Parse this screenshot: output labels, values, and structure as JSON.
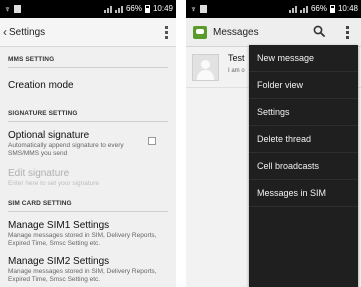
{
  "left_phone": {
    "status_bar": {
      "battery": "66%",
      "time": "10:49"
    },
    "action_bar": {
      "back": "‹",
      "title": "Settings"
    },
    "sections": [
      {
        "header": "MMS SETTING",
        "items": [
          {
            "title": "Creation mode",
            "summary": ""
          }
        ]
      },
      {
        "header": "SIGNATURE SETTING",
        "items": [
          {
            "title": "Optional signature",
            "summary": "Automatically append signature to every SMS/MMS you send",
            "checkbox": false
          },
          {
            "title": "Edit signature",
            "summary": "Enter here to set your signature",
            "disabled": true
          }
        ]
      },
      {
        "header": "SIM CARD SETTING",
        "items": [
          {
            "title": "Manage SIM1 Settings",
            "summary": "Manage messages stored in SIM, Delivery Reports, Expired Time, Smsc Setting etc."
          },
          {
            "title": "Manage SIM2 Settings",
            "summary": "Manage messages stored in SIM, Delivery Reports, Expired Time, Smsc Setting etc."
          }
        ]
      }
    ]
  },
  "right_phone": {
    "status_bar": {
      "battery": "66%",
      "time": "10:48"
    },
    "action_bar": {
      "title": "Messages"
    },
    "thread": {
      "name": "Test",
      "preview": "I am o"
    },
    "menu": [
      "New message",
      "Folder view",
      "Settings",
      "Delete thread",
      "Cell broadcasts",
      "Messages in SIM"
    ]
  },
  "colors": {
    "app_icon": "#5a9b2c",
    "menu_bg": "#1f1f1f",
    "status_bar": "#000000"
  }
}
